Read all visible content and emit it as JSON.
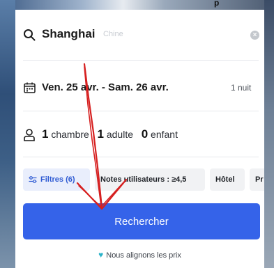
{
  "top_text": "p",
  "search": {
    "destination": "Shanghai",
    "country": "Chine",
    "clear_icon": "close-circle-icon",
    "clear_glyph": "×"
  },
  "dates": {
    "range": "Ven. 25 avr. - Sam. 26 avr.",
    "nights": "1 nuit"
  },
  "guests": {
    "rooms_count": "1",
    "rooms_label": "chambre",
    "adults_count": "1",
    "adults_label": "adulte",
    "children_count": "0",
    "children_label": "enfant"
  },
  "filters": {
    "filters_label": "Filtres (6)",
    "rating_label": "Notes utilisateurs : ≥4,5",
    "hotel_label": "Hôtel",
    "partial_label": "Pr"
  },
  "search_button": {
    "label": "Rechercher"
  },
  "price_promise": {
    "label": "Nous alignons les prix"
  },
  "colors": {
    "accent": "#3563e9",
    "annotation_arrow": "#d62020",
    "filter_chip_text": "#2f5bd3",
    "promise_icon": "#2bb3c9"
  }
}
